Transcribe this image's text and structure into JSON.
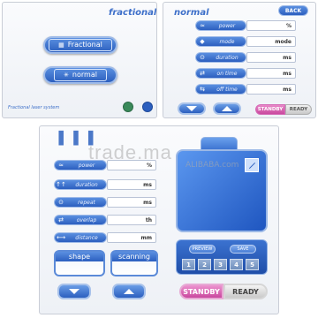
{
  "panel1": {
    "title": "fractional",
    "btn_fractional": "Fractional",
    "btn_normal": "normal",
    "footer": "Fractional laser system"
  },
  "panel2": {
    "title": "normal",
    "back": "BACK",
    "rows": [
      {
        "icon": "≈",
        "label": "power",
        "unit": "%"
      },
      {
        "icon": "◆",
        "label": "mode",
        "unit": "mode"
      },
      {
        "icon": "⊙",
        "label": "duration",
        "unit": "ms"
      },
      {
        "icon": "⇄",
        "label": "on time",
        "unit": "ms"
      },
      {
        "icon": "⇆",
        "label": "off time",
        "unit": "ms"
      }
    ],
    "standby": "STANDBY",
    "ready": "READY"
  },
  "panel3": {
    "rows": [
      {
        "icon": "≈",
        "label": "power",
        "unit": "%"
      },
      {
        "icon": "↑↑",
        "label": "duration",
        "unit": "ms"
      },
      {
        "icon": "⊙",
        "label": "repeat",
        "unit": "ms"
      },
      {
        "icon": "⇄",
        "label": "overlap",
        "unit": "th"
      },
      {
        "icon": "⟷",
        "label": "distance",
        "unit": "mm"
      }
    ],
    "shape": "shape",
    "scanning": "scanning",
    "preview": "PREVIEW",
    "save": "SAVE",
    "slots": [
      "1",
      "2",
      "3",
      "4",
      "5"
    ],
    "standby": "STANDBY",
    "ready": "READY"
  },
  "watermark": "trade.ma",
  "watermark_sub": "ALIBABA.com"
}
